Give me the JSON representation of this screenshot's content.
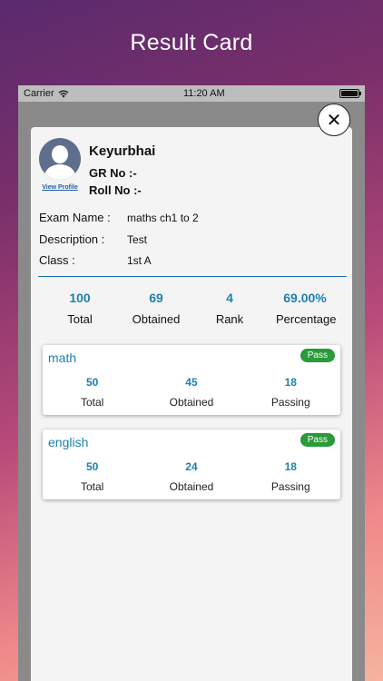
{
  "banner": {
    "title": "Result Card"
  },
  "status_bar": {
    "carrier": "Carrier",
    "time": "11:20 AM",
    "battery_level": 1.0
  },
  "student": {
    "name": "Keyurbhai",
    "gr_no": "GR No :-",
    "roll_no": "Roll No :-",
    "view_profile": "View Profile"
  },
  "exam": {
    "name_label": "Exam Name :",
    "name_value": "maths ch1 to 2",
    "description_label": "Description :",
    "description_value": "Test",
    "class_label": "Class :",
    "class_value": "1st A"
  },
  "summary": [
    {
      "value": "100",
      "label": "Total"
    },
    {
      "value": "69",
      "label": "Obtained"
    },
    {
      "value": "4",
      "label": "Rank"
    },
    {
      "value": "69.00%",
      "label": "Percentage"
    }
  ],
  "subjects": [
    {
      "name": "math",
      "status": "Pass",
      "stats": [
        {
          "value": "50",
          "label": "Total"
        },
        {
          "value": "45",
          "label": "Obtained"
        },
        {
          "value": "18",
          "label": "Passing"
        }
      ]
    },
    {
      "name": "english",
      "status": "Pass",
      "stats": [
        {
          "value": "50",
          "label": "Total"
        },
        {
          "value": "24",
          "label": "Obtained"
        },
        {
          "value": "18",
          "label": "Passing"
        }
      ]
    }
  ],
  "icons": {
    "close": "close-icon",
    "wifi": "wifi-icon",
    "battery": "battery-icon",
    "avatar": "user-avatar-icon"
  },
  "colors": {
    "accent": "#1e7fb0",
    "pass": "#2a9a3a"
  }
}
